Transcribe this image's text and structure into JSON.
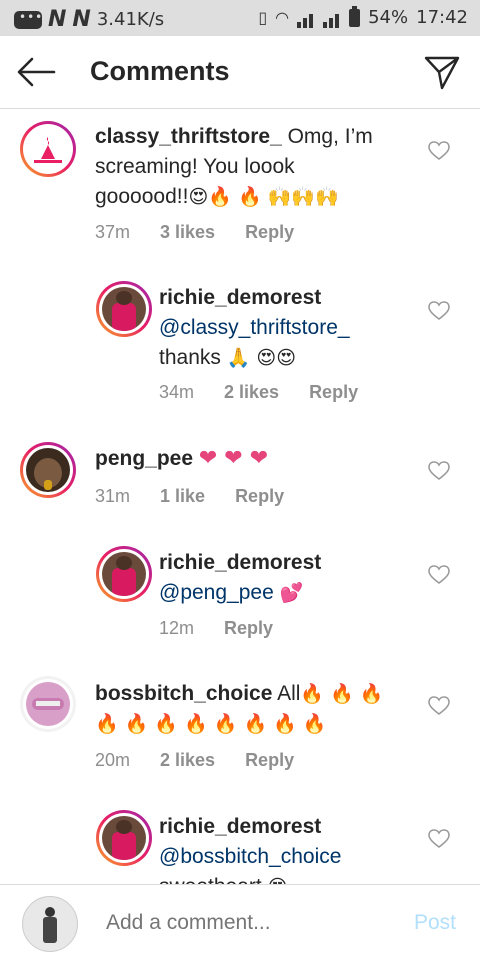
{
  "status": {
    "speed": "3.41K/s",
    "battery": "54%",
    "time": "17:42"
  },
  "header": {
    "title": "Comments"
  },
  "comments": [
    {
      "user": "classy_thriftstore_",
      "text": " Omg, I’m screaming! You loook goooood!!",
      "emoji": "😍🔥 🔥 🙌🙌🙌",
      "time": "37m",
      "likes": "3 likes",
      "reply": "Reply"
    },
    {
      "user": "richie_demorest",
      "mention": "@classy_thriftstore_",
      "text": " thanks ",
      "emoji": "🙏 😍😍",
      "time": "34m",
      "likes": "2 likes",
      "reply": "Reply"
    },
    {
      "user": "peng_pee",
      "text": " ",
      "emoji": "❤ ❤ ❤",
      "time": "31m",
      "likes": "1 like",
      "reply": "Reply"
    },
    {
      "user": "richie_demorest",
      "mention": "@peng_pee",
      "text": " ",
      "emoji": "💕",
      "time": "12m",
      "reply": "Reply"
    },
    {
      "user": "bossbitch_choice",
      "text": " All",
      "emoji": "🔥 🔥 🔥 🔥 🔥 🔥 🔥 🔥 🔥 🔥 🔥",
      "time": "20m",
      "likes": "2 likes",
      "reply": "Reply"
    },
    {
      "user": "richie_demorest",
      "mention": "@bossbitch_choice",
      "text": " sweetheart ",
      "emoji": "😍"
    }
  ],
  "footer": {
    "placeholder": "Add a comment...",
    "post": "Post"
  },
  "colors": {
    "mention": "#003569",
    "post_disabled": "#b2dffc",
    "heart_pink": "#e5457a"
  }
}
